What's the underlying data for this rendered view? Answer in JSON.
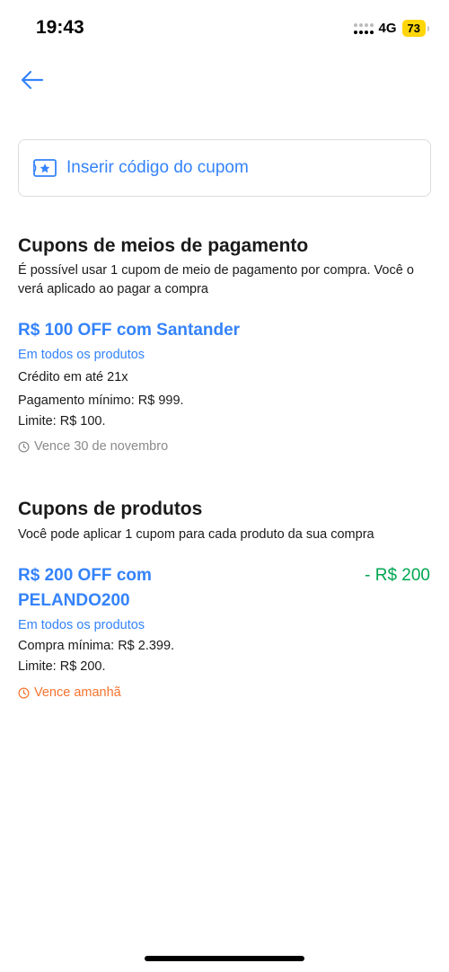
{
  "status_bar": {
    "time": "19:43",
    "network": "4G",
    "battery": "73"
  },
  "header": {
    "back_icon": "arrow-left-icon"
  },
  "coupon_input": {
    "icon": "ticket-star-icon",
    "label": "Inserir código do cupom"
  },
  "payment_section": {
    "title": "Cupons de meios de pagamento",
    "description": "É possível usar 1 cupom de meio de pagamento por compra. Você o verá aplicado ao pagar a compra",
    "coupons": [
      {
        "title": "R$ 100 OFF com Santander",
        "scope": "Em todos os produtos",
        "details": [
          "Crédito em até 21x",
          "Pagamento mínimo: R$ 999.",
          "Limite: R$ 100."
        ],
        "expiry": "Vence 30 de novembro"
      }
    ]
  },
  "product_section": {
    "title": "Cupons de produtos",
    "description": "Você pode aplicar 1 cupom para cada produto da sua compra",
    "coupons": [
      {
        "title_line1": "R$ 200 OFF com",
        "title_line2": "PELANDO200",
        "discount": "- R$ 200",
        "scope": "Em todos os produtos",
        "details": [
          "Compra mínima: R$ 2.399.",
          "Limite: R$ 200."
        ],
        "expiry": "Vence amanhã"
      }
    ]
  },
  "colors": {
    "accent": "#3483fa",
    "discount_green": "#00a650",
    "expiry_orange": "#f5732d",
    "muted": "#8a8a8a"
  }
}
